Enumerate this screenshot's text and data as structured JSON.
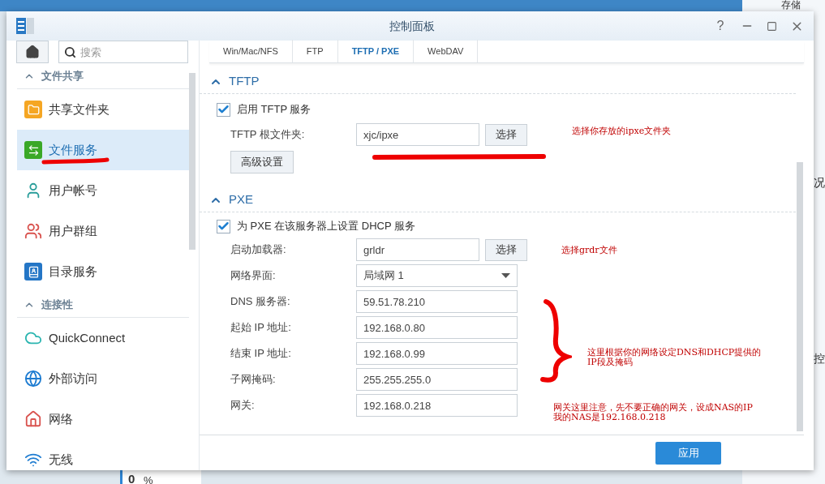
{
  "desktop": {
    "widget_title": "存储",
    "label_1": "况",
    "label_2": "控",
    "usage": "0",
    "usage_unit": "%"
  },
  "window": {
    "title": "控制面板",
    "help_glyph": "?"
  },
  "search": {
    "placeholder": "搜索"
  },
  "sidebar": {
    "sections": [
      {
        "title": "文件共享",
        "expanded": true,
        "items": [
          {
            "label": "共享文件夹",
            "selected": false
          },
          {
            "label": "文件服务",
            "selected": true
          },
          {
            "label": "用户帐号",
            "selected": false
          },
          {
            "label": "用户群组",
            "selected": false
          },
          {
            "label": "目录服务",
            "selected": false
          }
        ]
      },
      {
        "title": "连接性",
        "expanded": true,
        "items": [
          {
            "label": "QuickConnect",
            "selected": false
          },
          {
            "label": "外部访问",
            "selected": false
          },
          {
            "label": "网络",
            "selected": false
          },
          {
            "label": "无线",
            "selected": false
          }
        ]
      }
    ]
  },
  "tabs": [
    {
      "label": "Win/Mac/NFS",
      "selected": false
    },
    {
      "label": "FTP",
      "selected": false
    },
    {
      "label": "TFTP / PXE",
      "selected": true
    },
    {
      "label": "WebDAV",
      "selected": false
    }
  ],
  "tftp": {
    "title": "TFTP",
    "expanded": true,
    "enable": {
      "label": "启用 TFTP 服务",
      "checked": true
    },
    "root_folder": {
      "label": "TFTP 根文件夹:",
      "value": "xjc/ipxe",
      "button": "选择"
    },
    "advanced_button": "高级设置"
  },
  "pxe": {
    "title": "PXE",
    "expanded": true,
    "dhcp": {
      "label": "为 PXE 在该服务器上设置 DHCP 服务",
      "checked": true
    },
    "fields": [
      {
        "kind": "browse",
        "label": "启动加载器:",
        "value": "grldr",
        "button": "选择"
      },
      {
        "kind": "select",
        "label": "网络界面:",
        "value": "局域网 1"
      },
      {
        "kind": "text",
        "label": "DNS 服务器:",
        "value": "59.51.78.210"
      },
      {
        "kind": "text",
        "label": "起始 IP 地址:",
        "value": "192.168.0.80"
      },
      {
        "kind": "text",
        "label": "结束 IP 地址:",
        "value": "192.168.0.99"
      },
      {
        "kind": "text",
        "label": "子网掩码:",
        "value": "255.255.255.0"
      },
      {
        "kind": "text",
        "label": "网关:",
        "value": "192.168.0.218"
      }
    ]
  },
  "apply_button": "应用",
  "annotations": [
    {
      "lines": [
        "选择你存放的ipxe文件夹"
      ]
    },
    {
      "lines": [
        "选择grdr文件"
      ]
    },
    {
      "lines": [
        "这里根据你的网络设定DNS和DHCP提供的",
        "IP段及掩码"
      ]
    },
    {
      "lines": [
        "网关这里注意，先不要正确的网关，设成NAS的IP",
        "我的NAS是192.168.0.218"
      ]
    }
  ]
}
